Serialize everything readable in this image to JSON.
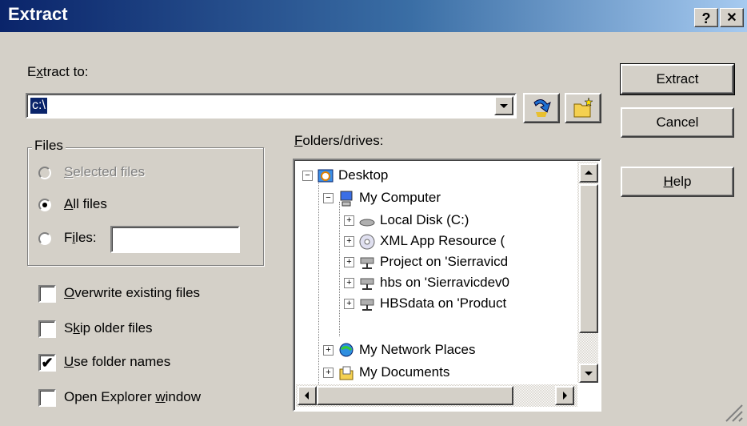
{
  "window": {
    "title": "Extract",
    "help_glyph": "?",
    "close_glyph": "✕"
  },
  "extract_to": {
    "label_pre": "E",
    "label_accel": "x",
    "label_post": "tract to:",
    "value": "c:\\"
  },
  "buttons": {
    "extract": "Extract",
    "cancel": "Cancel",
    "help_accel": "H",
    "help_rest": "elp"
  },
  "files_group": {
    "legend": "Files",
    "selected": {
      "accel": "S",
      "rest": "elected files"
    },
    "all": {
      "accel": "A",
      "rest": "ll files"
    },
    "files": {
      "pre": "F",
      "accel": "i",
      "rest": "les:",
      "value": ""
    }
  },
  "options": {
    "overwrite": {
      "accel": "O",
      "rest": "verwrite existing files",
      "checked": false
    },
    "skip": {
      "pre": "S",
      "accel": "k",
      "rest": "ip older files",
      "checked": false
    },
    "folder_names": {
      "accel": "U",
      "rest": "se folder names",
      "checked": true,
      "mark": "✔"
    },
    "explorer": {
      "pre": "Open Explorer ",
      "accel": "w",
      "rest": "indow",
      "checked": false
    }
  },
  "folders": {
    "label_accel": "F",
    "label_rest": "olders/drives:",
    "tree": [
      {
        "label": "Desktop",
        "sign": "−",
        "icon": "desktop-icon"
      },
      {
        "label": "My Computer",
        "sign": "−",
        "icon": "computer-icon"
      },
      {
        "label": "Local Disk (C:)",
        "sign": "+",
        "icon": "disk-icon"
      },
      {
        "label": "XML App Resource (",
        "sign": "+",
        "icon": "cd-icon"
      },
      {
        "label": "Project on 'Sierravicd",
        "sign": "+",
        "icon": "network-drive-icon"
      },
      {
        "label": "hbs on 'Sierravicdev0",
        "sign": "+",
        "icon": "network-drive-icon"
      },
      {
        "label": "HBSdata on 'Product",
        "sign": "+",
        "icon": "network-drive-icon"
      },
      {
        "label": "My Network Places",
        "sign": "+",
        "icon": "network-places-icon"
      },
      {
        "label": "My Documents",
        "sign": "+",
        "icon": "documents-icon"
      }
    ]
  }
}
